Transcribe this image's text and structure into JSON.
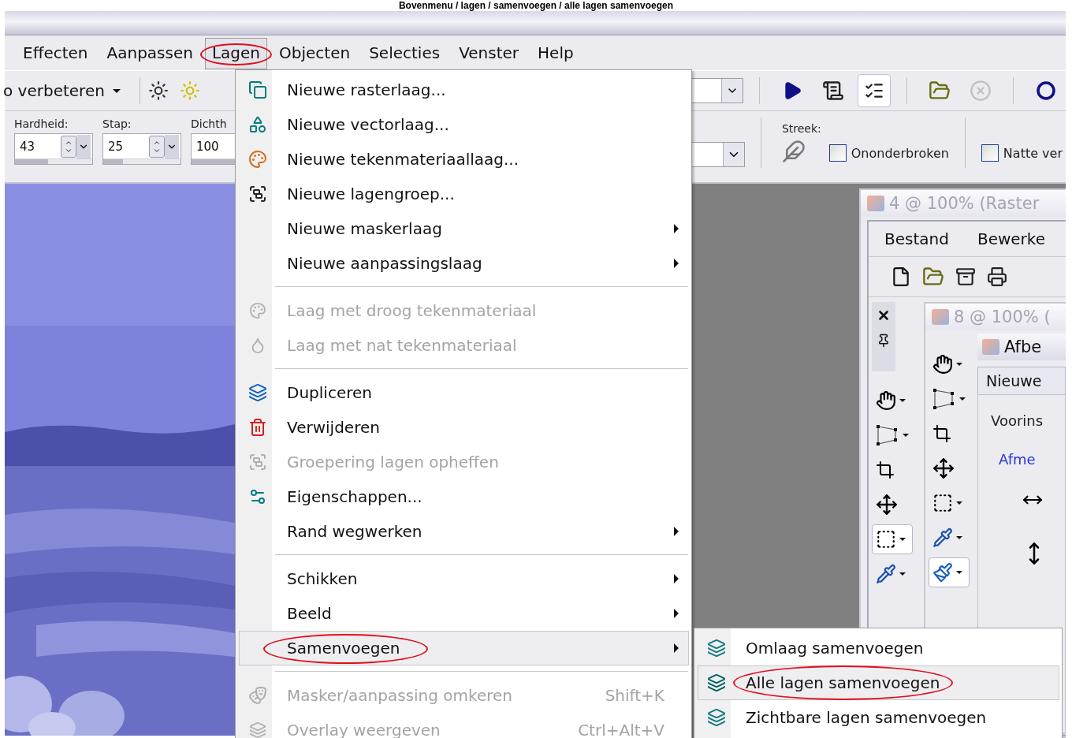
{
  "caption": "Bovenmenu / lagen / samenvoegen / alle lagen samenvoegen",
  "menubar": [
    {
      "label": "Effecten",
      "selected": false
    },
    {
      "label": "Aanpassen",
      "selected": false
    },
    {
      "label": "Lagen",
      "selected": true
    },
    {
      "label": "Objecten",
      "selected": false
    },
    {
      "label": "Selecties",
      "selected": false
    },
    {
      "label": "Venster",
      "selected": false
    },
    {
      "label": "Help",
      "selected": false
    }
  ],
  "preset": {
    "label": "o verbeteren"
  },
  "brush_options": [
    {
      "label": "Hardheid:",
      "value": "43",
      "level": 0.43
    },
    {
      "label": "Stap:",
      "value": "25",
      "level": 0.25
    },
    {
      "label": "Dichth",
      "value": "100",
      "level": 1
    }
  ],
  "stroke": {
    "label": "Streek:"
  },
  "checkboxes": [
    {
      "label": "Ononderbroken",
      "checked": false
    },
    {
      "label": "Natte ver",
      "checked": false
    }
  ],
  "menu": {
    "items": [
      {
        "kind": "item",
        "label": "Nieuwe rasterlaag...",
        "disabled": false,
        "submenu": false,
        "selected": false
      },
      {
        "kind": "item",
        "label": "Nieuwe vectorlaag...",
        "disabled": false,
        "submenu": false,
        "selected": false
      },
      {
        "kind": "item",
        "label": "Nieuwe tekenmateriaallaag...",
        "disabled": false,
        "submenu": false,
        "selected": false
      },
      {
        "kind": "item",
        "label": "Nieuwe lagengroep...",
        "disabled": false,
        "submenu": false,
        "selected": false
      },
      {
        "kind": "item",
        "label": "Nieuwe maskerlaag",
        "disabled": false,
        "submenu": true,
        "selected": false
      },
      {
        "kind": "item",
        "label": "Nieuwe aanpassingslaag",
        "disabled": false,
        "submenu": true,
        "selected": false
      },
      {
        "kind": "separator"
      },
      {
        "kind": "item",
        "label": "Laag met droog tekenmateriaal",
        "disabled": true,
        "submenu": false,
        "selected": false
      },
      {
        "kind": "item",
        "label": "Laag met nat tekenmateriaal",
        "disabled": true,
        "submenu": false,
        "selected": false
      },
      {
        "kind": "separator"
      },
      {
        "kind": "item",
        "label": "Dupliceren",
        "disabled": false,
        "submenu": false,
        "selected": false
      },
      {
        "kind": "item",
        "label": "Verwijderen",
        "disabled": false,
        "submenu": false,
        "selected": false
      },
      {
        "kind": "item",
        "label": "Groepering lagen opheffen",
        "disabled": true,
        "submenu": false,
        "selected": false
      },
      {
        "kind": "item",
        "label": "Eigenschappen...",
        "disabled": false,
        "submenu": false,
        "selected": false
      },
      {
        "kind": "item",
        "label": "Rand wegwerken",
        "disabled": false,
        "submenu": true,
        "selected": false
      },
      {
        "kind": "separator"
      },
      {
        "kind": "item",
        "label": "Schikken",
        "disabled": false,
        "submenu": true,
        "selected": false
      },
      {
        "kind": "item",
        "label": "Beeld",
        "disabled": false,
        "submenu": true,
        "selected": false
      },
      {
        "kind": "item",
        "label": "Samenvoegen",
        "disabled": false,
        "submenu": true,
        "selected": true
      },
      {
        "kind": "separator"
      },
      {
        "kind": "item",
        "label": "Masker/aanpassing omkeren",
        "shortcut": "Shift+K",
        "disabled": true,
        "submenu": false,
        "selected": false
      },
      {
        "kind": "item",
        "label": "Overlay weergeven",
        "shortcut": "Ctrl+Alt+V",
        "disabled": true,
        "submenu": false,
        "selected": false
      }
    ]
  },
  "submenu": {
    "items": [
      {
        "label": "Omlaag samenvoegen",
        "selected": false
      },
      {
        "label": "Alle lagen samenvoegen",
        "selected": true
      },
      {
        "label": "Zichtbare lagen samenvoegen",
        "selected": false
      }
    ]
  },
  "doc_window": {
    "title": "4 @ 100% (Raster",
    "menus": [
      "Bestand",
      "Bewerke"
    ],
    "inner_title": "8 @ 100% (",
    "image_title": "Afbe",
    "dialog_tab": "Nieuwe",
    "preset_label": "Voorins",
    "group_label": "Afme"
  }
}
